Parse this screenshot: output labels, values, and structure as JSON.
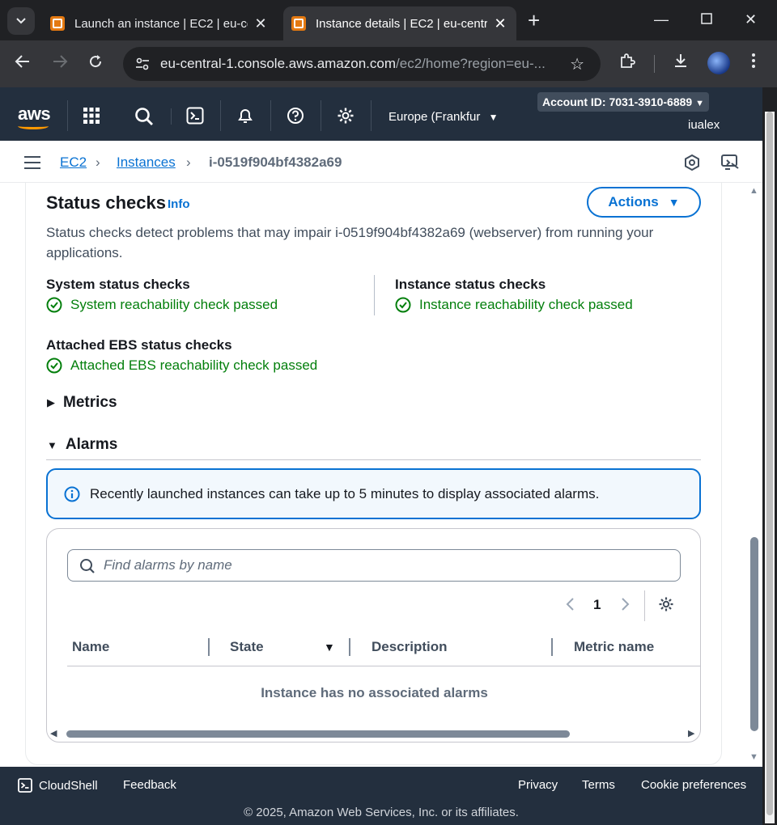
{
  "browser": {
    "tabs": [
      {
        "title": "Launch an instance | EC2 | eu-ce",
        "active": false
      },
      {
        "title": "Instance details | EC2 | eu-centr",
        "active": true
      }
    ],
    "url_host": "eu-central-1.console.aws.amazon.com",
    "url_path": "/ec2/home?region=eu-..."
  },
  "aws_header": {
    "logo": "aws",
    "region": "Europe (Frankfur",
    "account": "Account ID: 7031-3910-6889",
    "user": "iualex"
  },
  "breadcrumb": {
    "items": [
      "EC2",
      "Instances"
    ],
    "current": "i-0519f904bf4382a69"
  },
  "status_checks": {
    "title": "Status checks",
    "info_label": "Info",
    "actions_label": "Actions",
    "description": "Status checks detect problems that may impair i-0519f904bf4382a69 (webserver) from running your applications.",
    "system": {
      "label": "System status checks",
      "value": "System reachability check passed"
    },
    "instance": {
      "label": "Instance status checks",
      "value": "Instance reachability check passed"
    },
    "ebs": {
      "label": "Attached EBS status checks",
      "value": "Attached EBS reachability check passed"
    }
  },
  "sections": {
    "metrics": "Metrics",
    "alarms": "Alarms"
  },
  "alarms": {
    "info_text": "Recently launched instances can take up to 5 minutes to display associated alarms.",
    "search_placeholder": "Find alarms by name",
    "page": "1",
    "columns": [
      "Name",
      "State",
      "Description",
      "Metric name"
    ],
    "empty_text": "Instance has no associated alarms"
  },
  "footer": {
    "cloudshell": "CloudShell",
    "feedback": "Feedback",
    "privacy": "Privacy",
    "terms": "Terms",
    "cookies": "Cookie preferences",
    "copyright": "© 2025, Amazon Web Services, Inc. or its affiliates."
  },
  "colors": {
    "aws_nav": "#232f3e",
    "link_blue": "#0972d3",
    "success_green": "#037f0c",
    "aws_orange": "#ff9900"
  }
}
